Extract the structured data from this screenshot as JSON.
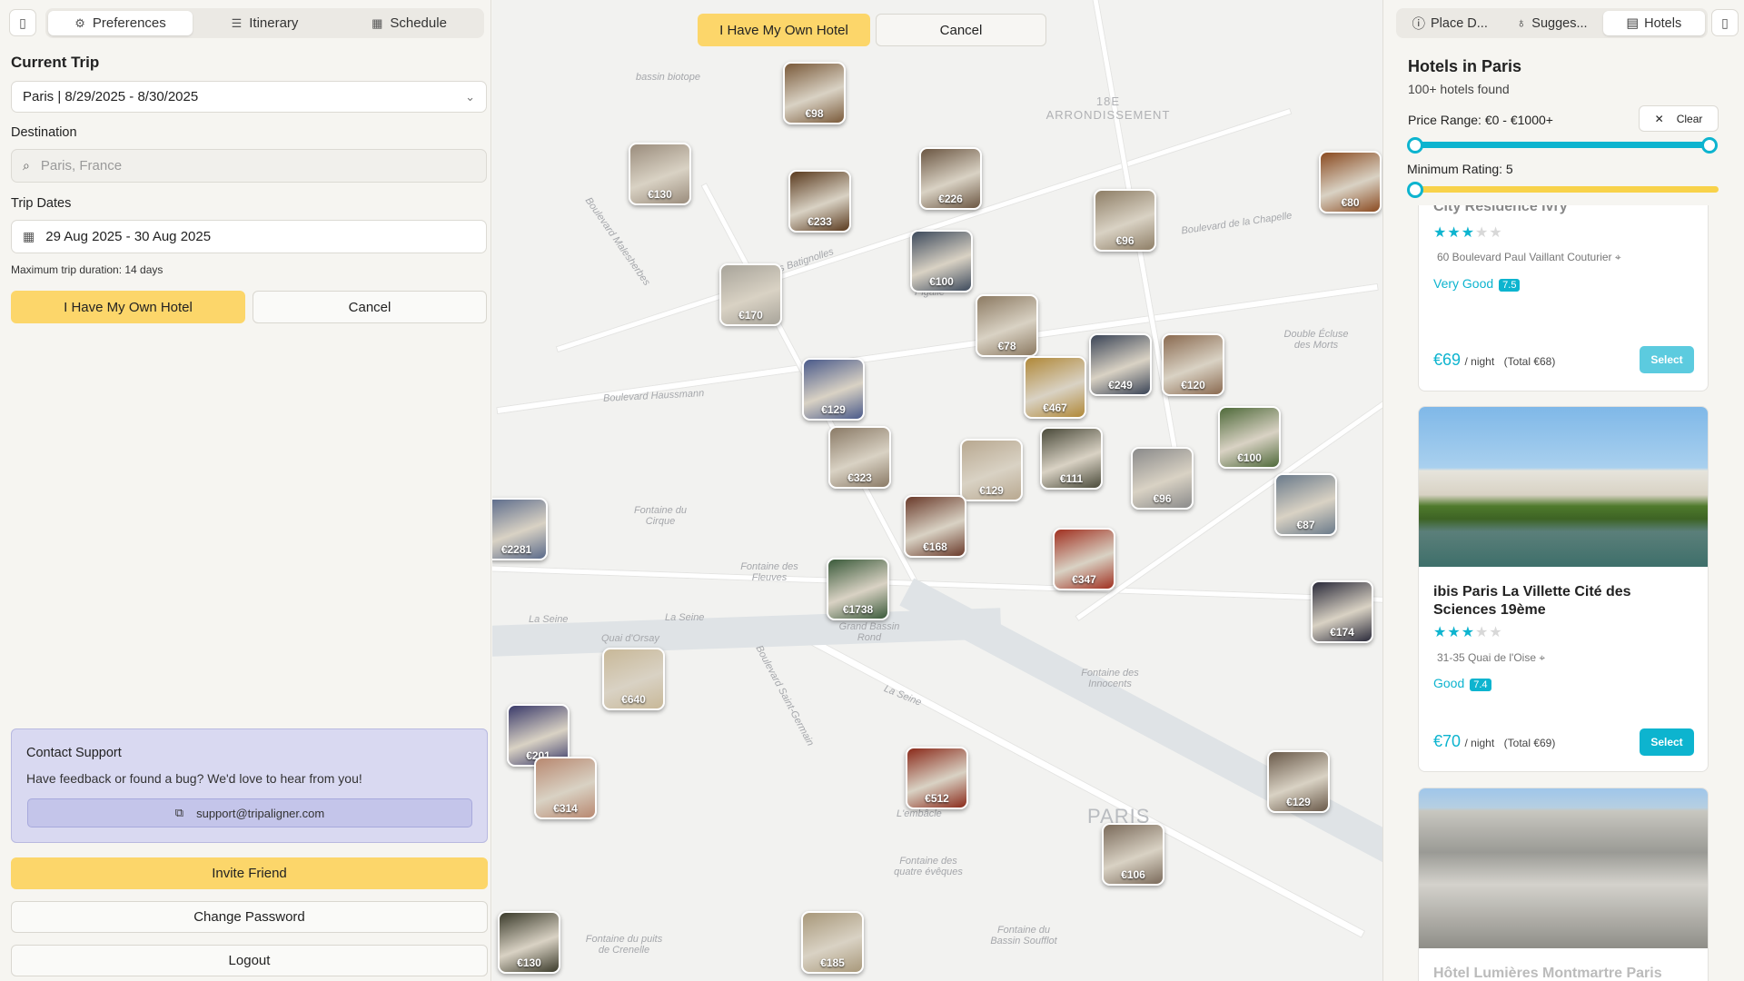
{
  "left": {
    "tabs": [
      {
        "label": "Preferences",
        "icon": "gear-icon"
      },
      {
        "label": "Itinerary",
        "icon": "list-icon"
      },
      {
        "label": "Schedule",
        "icon": "calendar-icon"
      }
    ],
    "current_trip_label": "Current Trip",
    "trip_select_value": "Paris | 8/29/2025 - 8/30/2025",
    "destination_label": "Destination",
    "destination_placeholder": "Paris, France",
    "dates_label": "Trip Dates",
    "dates_value": "29 Aug 2025 - 30 Aug 2025",
    "max_duration": "Maximum trip duration: 14 days",
    "own_hotel_button": "I Have My Own Hotel",
    "cancel_button": "Cancel",
    "support": {
      "title": "Contact Support",
      "desc": "Have feedback or found a bug? We'd love to hear from you!",
      "email": "support@tripaligner.com"
    },
    "invite_button": "Invite Friend",
    "change_password_button": "Change Password",
    "logout_button": "Logout"
  },
  "map": {
    "own_hotel_button": "I Have My Own Hotel",
    "cancel_button": "Cancel",
    "labels": {
      "arrondissement": "18E ARRONDISSEMENT",
      "city": "PARIS",
      "bassin": "bassin biotope",
      "bd_maleherbes": "Boulevard Malesherbes",
      "batignolles": "Rue des Batignolles",
      "haussmann": "Boulevard Haussmann",
      "chapelle": "Boulevard de la Chapelle",
      "seine1": "La Seine",
      "seine2": "La Seine",
      "seine3": "La Seine",
      "quai_orsay": "Quai d'Orsay",
      "saint_germain": "Boulevard Saint-Germain",
      "fontaine_cirque": "Fontaine du Cirque",
      "fontaine_fleuves": "Fontaine des Fleuves",
      "innocents": "Fontaine des Innocents",
      "grand_bassin": "Grand Bassin Rond",
      "quatre_eveques": "Fontaine des quatre évêques",
      "bassin_soufflot": "Fontaine du Bassin Soufflot",
      "puits_grenelle": "Fontaine du puits de Crenelle",
      "double_ecluse": "Double Écluse des Morts",
      "pigalle": "Pigalle",
      "embouche": "L'embâcle"
    },
    "pins": [
      "€98",
      "€130",
      "€233",
      "€226",
      "€80",
      "€96",
      "€100",
      "€170",
      "€78",
      "€249",
      "€120",
      "€129",
      "€467",
      "€323",
      "€129",
      "€111",
      "€100",
      "€96",
      "€87",
      "€2281",
      "€168",
      "€347",
      "€1738",
      "€174",
      "€640",
      "€201",
      "€314",
      "€512",
      "€129",
      "€106",
      "€130",
      "€185"
    ]
  },
  "right": {
    "tabs": [
      {
        "label": "Place D...",
        "icon": "info-icon"
      },
      {
        "label": "Sugges...",
        "icon": "lightbulb-icon"
      },
      {
        "label": "Hotels",
        "icon": "building-icon"
      }
    ],
    "title": "Hotels in Paris",
    "count": "100+ hotels found",
    "price_range_label": "Price Range: €0 - €1000+",
    "clear_label": "Clear",
    "price_range": [
      0,
      1000
    ],
    "min_rating_label": "Minimum Rating: 5",
    "min_rating": 5,
    "accent": "#0db4cf",
    "hotels": [
      {
        "name": "City Résidence Ivry",
        "stars": 3,
        "address": "60 Boulevard Paul Vaillant Couturier",
        "rating_text": "Very Good",
        "rating": "7.5",
        "price": "€69",
        "per": "/ night",
        "total": "(Total €68)",
        "select": "Select"
      },
      {
        "name": "ibis Paris La Villette Cité des Sciences 19ème",
        "stars": 3,
        "address": "31-35 Quai de l'Oise",
        "rating_text": "Good",
        "rating": "7.4",
        "price": "€70",
        "per": "/ night",
        "total": "(Total €69)",
        "select": "Select"
      },
      {
        "name": "Hôtel Lumières Montmartre Paris"
      }
    ]
  }
}
